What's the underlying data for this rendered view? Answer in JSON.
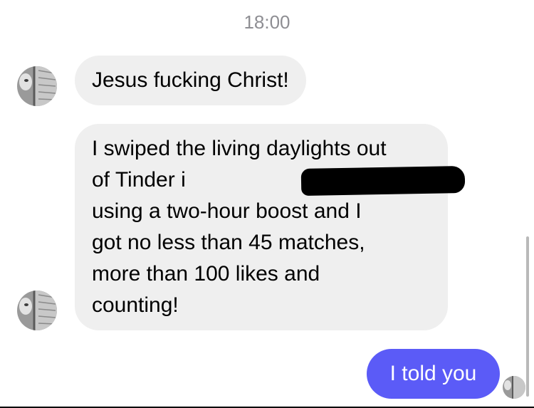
{
  "timestamp": "18:00",
  "messages": [
    {
      "direction": "incoming",
      "lines": [
        "Jesus fucking Christ!"
      ]
    },
    {
      "direction": "incoming",
      "lines": [
        "I swiped the living daylights out",
        "of Tinder i",
        "using a two-hour boost and I",
        "got no less than 45 matches,",
        "more than 100 likes and",
        "counting!"
      ],
      "redacted": true
    },
    {
      "direction": "outgoing",
      "lines": [
        "I told you"
      ]
    }
  ],
  "colors": {
    "incoming_bubble": "#efefef",
    "outgoing_bubble": "#5b5bf7",
    "timestamp_text": "#8e8e93"
  }
}
